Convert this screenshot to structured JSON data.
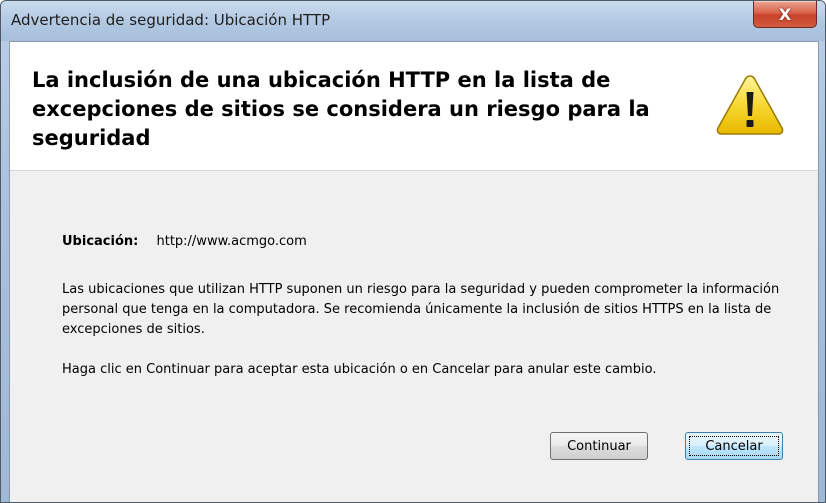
{
  "window": {
    "title": "Advertencia de seguridad: Ubicación HTTP",
    "close_glyph": "X"
  },
  "header": {
    "headline": "La inclusión de una ubicación HTTP en la lista de excepciones de sitios se considera un riesgo para la seguridad",
    "icon": "warning-icon"
  },
  "body": {
    "location_label": "Ubicación:",
    "location_value": "http://www.acmgo.com",
    "paragraph1": "Las ubicaciones que utilizan HTTP suponen un riesgo para la seguridad y pueden comprometer la información personal que tenga en la computadora. Se recomienda únicamente la inclusión de sitios HTTPS en la lista de excepciones de sitios.",
    "paragraph2": "Haga clic en Continuar para aceptar esta ubicación o en Cancelar para anular este cambio."
  },
  "buttons": {
    "continue_label": "Continuar",
    "cancel_label": "Cancelar"
  },
  "colors": {
    "titlebar": "#b3c9e2",
    "close_button": "#c7432c",
    "warning_fill": "#f5d12a",
    "focused_button_border": "#3c7fb1"
  }
}
